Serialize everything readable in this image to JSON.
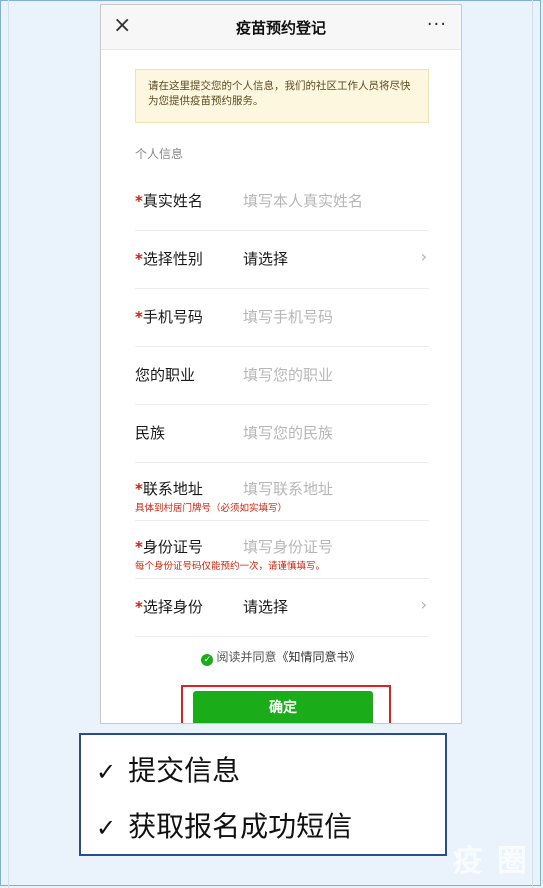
{
  "window": {
    "title": "疫苗预约登记",
    "close_icon": "×",
    "more_icon": "···"
  },
  "notice": {
    "text": "请在这里提交您的个人信息，我们的社区工作人员将尽快为您提供疫苗预约服务。"
  },
  "section": {
    "title": "个人信息"
  },
  "fields": {
    "name": {
      "required": true,
      "label": "真实姓名",
      "placeholder": "填写本人真实姓名"
    },
    "gender": {
      "required": true,
      "label": "选择性别",
      "value": "请选择"
    },
    "phone": {
      "required": true,
      "label": "手机号码",
      "placeholder": "填写手机号码"
    },
    "job": {
      "required": false,
      "label": "您的职业",
      "placeholder": "填写您的职业"
    },
    "ethnicity": {
      "required": false,
      "label": "民族",
      "placeholder": "填写您的民族"
    },
    "address": {
      "required": true,
      "label": "联系地址",
      "placeholder": "填写联系地址",
      "hint": "具体到村居门牌号（必须如实填写）"
    },
    "id_number": {
      "required": true,
      "label": "身份证号",
      "placeholder": "填写身份证号",
      "hint": "每个身份证号码仅能预约一次，请谨慎填写。"
    },
    "identity": {
      "required": true,
      "label": "选择身份",
      "value": "请选择"
    }
  },
  "agreement": {
    "prefix": "阅读并同意",
    "link": "《知情同意书》"
  },
  "confirm_button": "确定",
  "info_box": {
    "line1": "提交信息",
    "line2": "获取报名成功短信",
    "tick": "✓"
  },
  "watermark": "疫 圈",
  "colors": {
    "accent_green": "#1aad19",
    "required_red": "#d81e06",
    "highlight_red": "#e02020",
    "box_blue": "#2a4d8f"
  }
}
